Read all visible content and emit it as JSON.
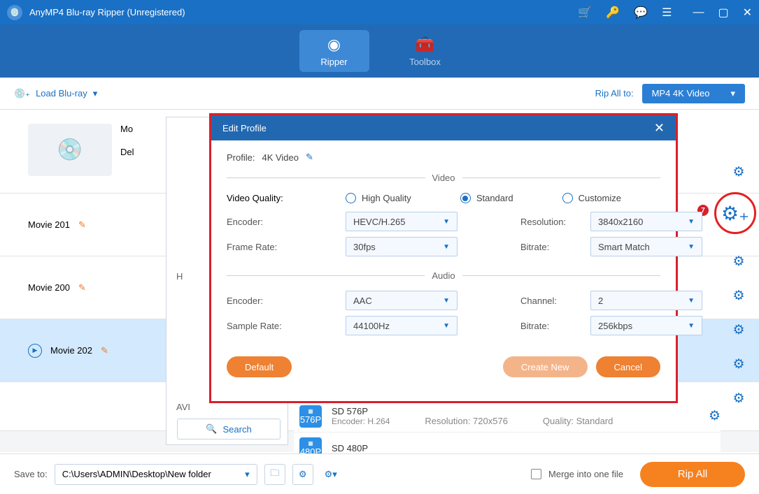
{
  "title": "AnyMP4 Blu-ray Ripper (Unregistered)",
  "tabs": {
    "ripper": "Ripper",
    "toolbox": "Toolbox"
  },
  "toolbar": {
    "load": "Load Blu-ray",
    "ripall_label": "Rip All to:",
    "format": "MP4 4K Video"
  },
  "movies": {
    "m0_label": "Mo",
    "m0_del": "Del",
    "m1": "Movie 201",
    "m2": "Movie 200",
    "m3": "Movie 202"
  },
  "search": "Search",
  "side": {
    "h": "H",
    "avi": "AVI"
  },
  "fmt": {
    "r1_name": "SD 576P",
    "r1_enc": "Encoder: H.264",
    "r1_res": "Resolution: 720x576",
    "r1_q": "Quality: Standard",
    "r2_name": "SD 480P",
    "b1": "576P",
    "b2": "480P"
  },
  "modal": {
    "title": "Edit Profile",
    "profile_lbl": "Profile:",
    "profile_val": "4K Video",
    "video_sect": "Video",
    "audio_sect": "Audio",
    "vq": "Video Quality:",
    "hq": "High Quality",
    "std": "Standard",
    "cust": "Customize",
    "encoder": "Encoder:",
    "venc": "HEVC/H.265",
    "res": "Resolution:",
    "resv": "3840x2160",
    "fr": "Frame Rate:",
    "frv": "30fps",
    "br": "Bitrate:",
    "vbrv": "Smart Match",
    "aenc": "AAC",
    "ch": "Channel:",
    "chv": "2",
    "sr": "Sample Rate:",
    "srv": "44100Hz",
    "abrv": "256kbps",
    "default": "Default",
    "create": "Create New",
    "cancel": "Cancel"
  },
  "badge": "7",
  "footer": {
    "save": "Save to:",
    "path": "C:\\Users\\ADMIN\\Desktop\\New folder",
    "merge": "Merge into one file",
    "ripall": "Rip All"
  }
}
